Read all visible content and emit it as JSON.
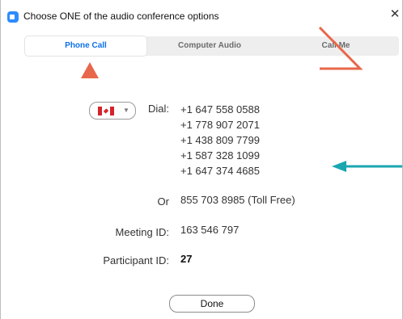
{
  "window": {
    "title": "Choose ONE of the audio conference options",
    "close_glyph": "✕"
  },
  "tabs": [
    {
      "label": "Phone Call",
      "active": true
    },
    {
      "label": "Computer Audio",
      "active": false
    },
    {
      "label": "Call Me",
      "active": false
    }
  ],
  "country_selector": {
    "selected": "Canada",
    "icon": "canada-flag-icon"
  },
  "dial": {
    "label": "Dial:",
    "numbers": [
      "+1 647 558 0588",
      "+1 778 907 2071",
      "+1 438 809 7799",
      "+1 587 328 1099",
      "+1 647 374 4685"
    ]
  },
  "toll_free": {
    "label": "Or",
    "number": "855 703 8985 (Toll Free)"
  },
  "meeting_id": {
    "label": "Meeting ID:",
    "value": "163 546 797"
  },
  "participant_id": {
    "label": "Participant ID:",
    "value": "27"
  },
  "done_button": {
    "label": "Done"
  },
  "annotation_colors": {
    "orange": "#e8674a",
    "teal": "#1aa6b0"
  },
  "colors": {
    "accent_blue": "#0e71eb",
    "tab_bar": "#eeeeee"
  }
}
